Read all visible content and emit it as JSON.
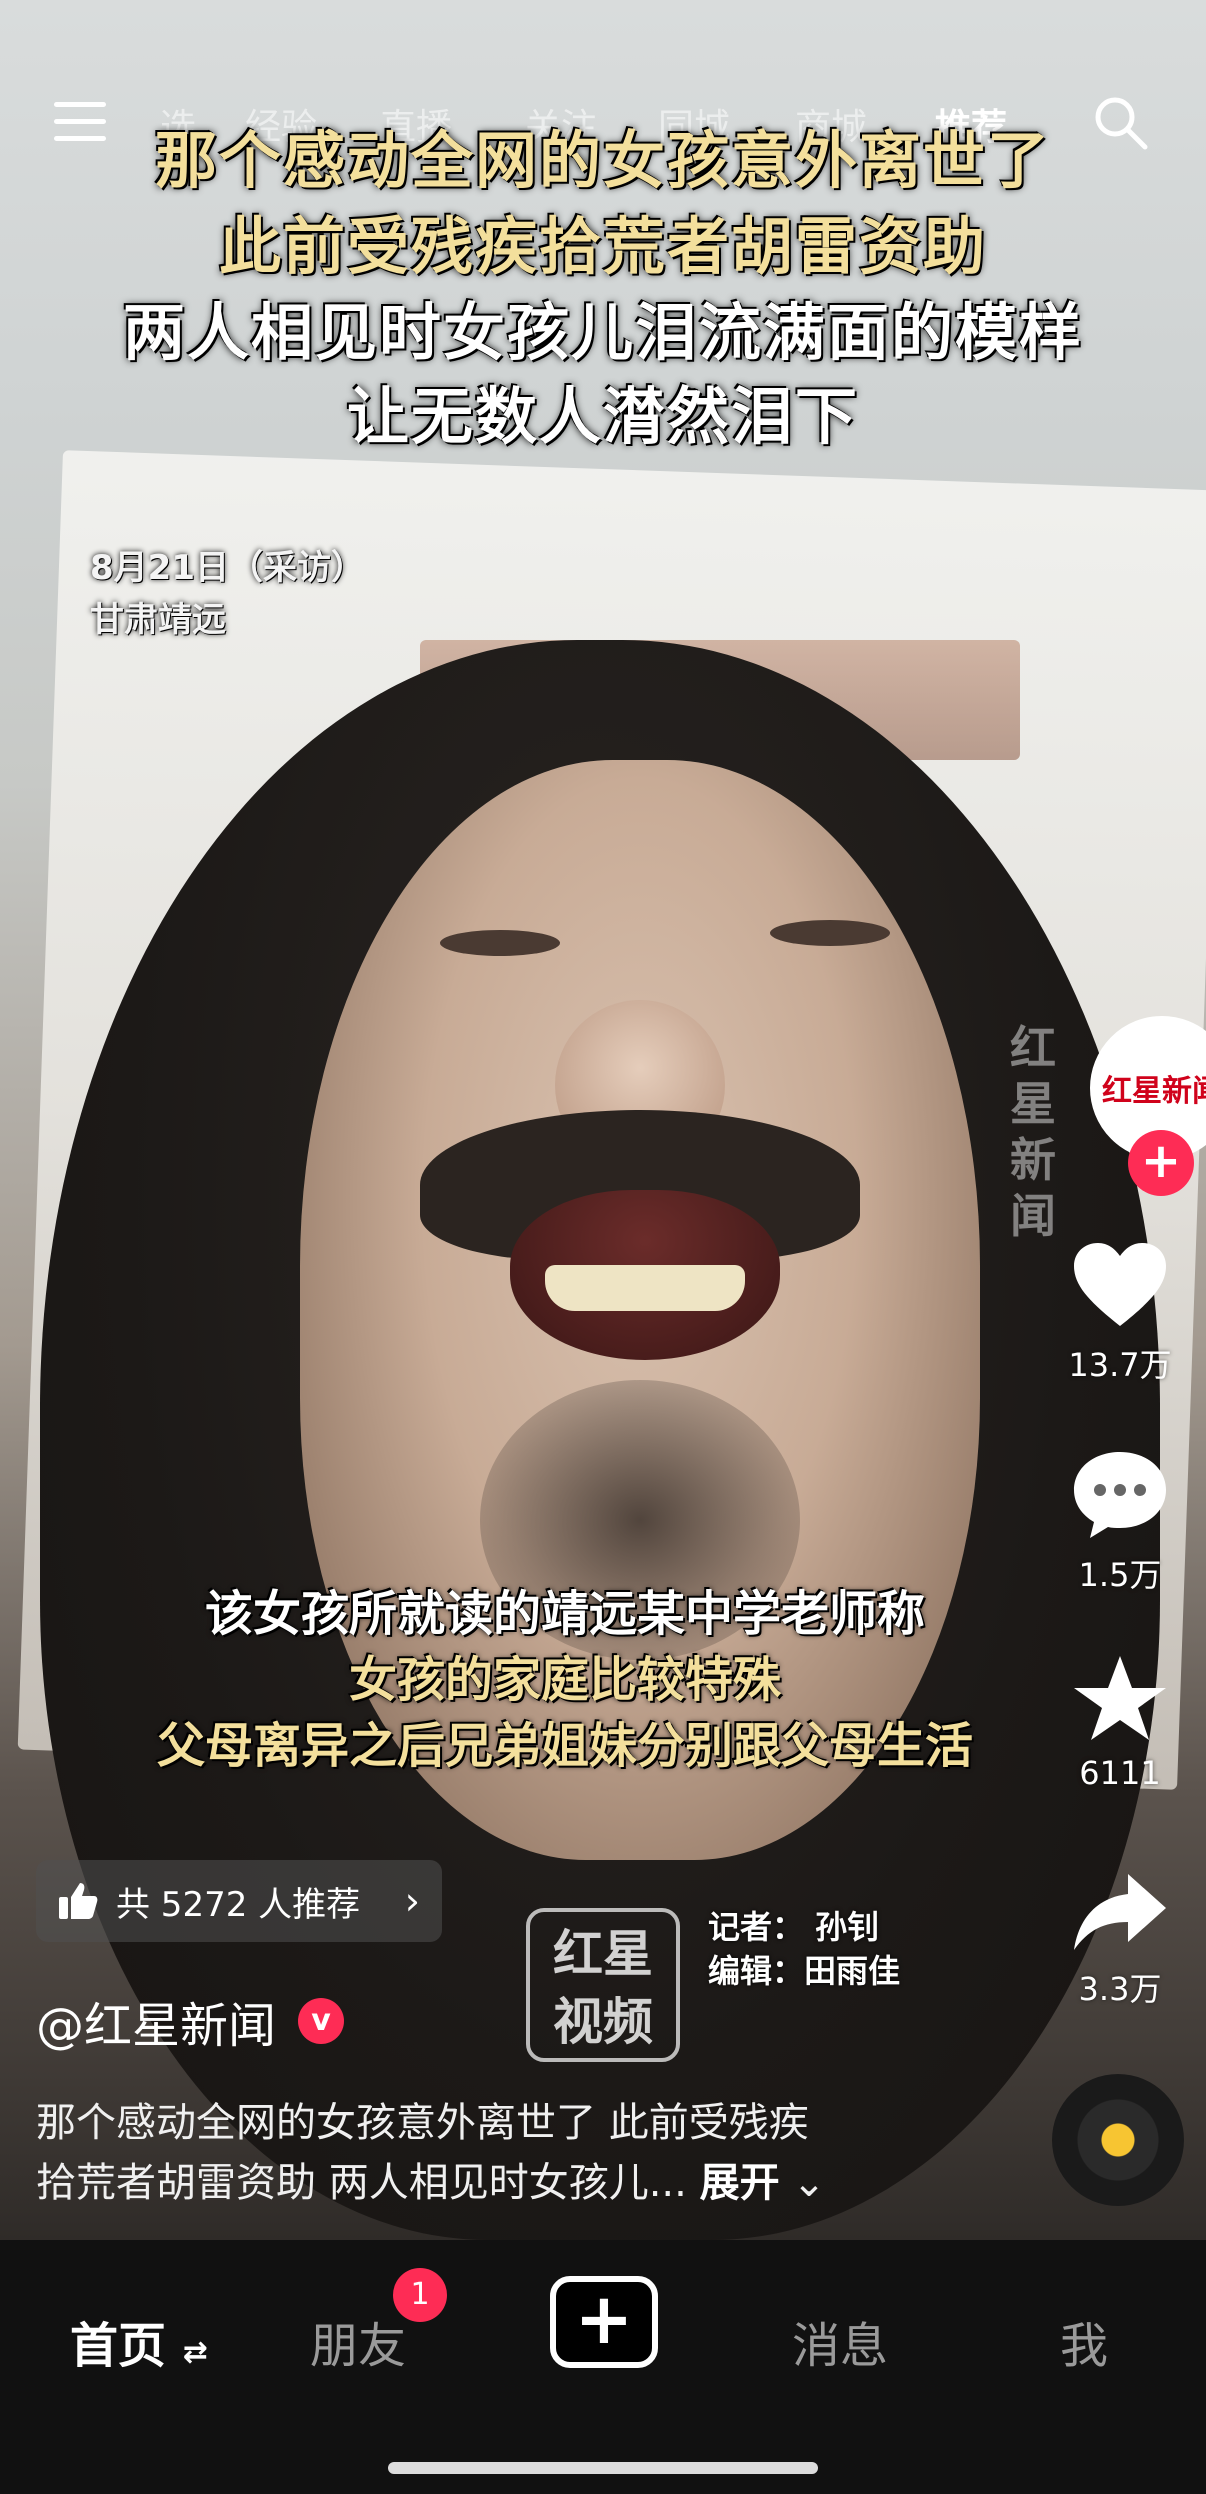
{
  "top_nav": {
    "tabs": [
      "选",
      "经验",
      "直播",
      "关注",
      "同城",
      "商城",
      "推荐"
    ],
    "active_tab": "推荐"
  },
  "overlay": {
    "headline": [
      "那个感动全网的女孩意外离世了",
      "此前受残疾拾荒者胡雷资助",
      "两人相见时女孩儿泪流满面的模样",
      "让无数人潸然泪下"
    ],
    "date_caption": "8月21日（采访）",
    "place_caption": "甘肃靖远",
    "subtitles": [
      "该女孩所就读的靖远某中学老师称",
      "女孩的家庭比较特殊",
      "父母离异之后兄弟姐妹分别跟父母生活"
    ],
    "watermark": "红星新闻",
    "logo_text": [
      "红星",
      "视频"
    ],
    "credits": [
      "记者：  孙钊",
      "编辑：田雨佳"
    ]
  },
  "side_rail": {
    "avatar_text": "红星新闻",
    "follow_symbol": "+",
    "likes": "13.7万",
    "comments": "1.5万",
    "favorites": "6111",
    "shares": "3.3万"
  },
  "recommend": {
    "label": "共 5272 人推荐",
    "chevron": "›"
  },
  "author": {
    "name": "@红星新闻",
    "verified_symbol": "v"
  },
  "description": {
    "line1": "那个感动全网的女孩意外离世了 此前受残疾",
    "line2": "拾荒者胡雷资助 两人相见时女孩儿...",
    "expand": "展开"
  },
  "bottom_nav": {
    "home": "首页",
    "friends": "朋友",
    "friends_badge": "1",
    "create": "+",
    "messages": "消息",
    "me": "我"
  },
  "colors": {
    "accent": "#fe2c55",
    "subtitle_gold": "#f3df9c",
    "bar_bg": "#111111"
  }
}
